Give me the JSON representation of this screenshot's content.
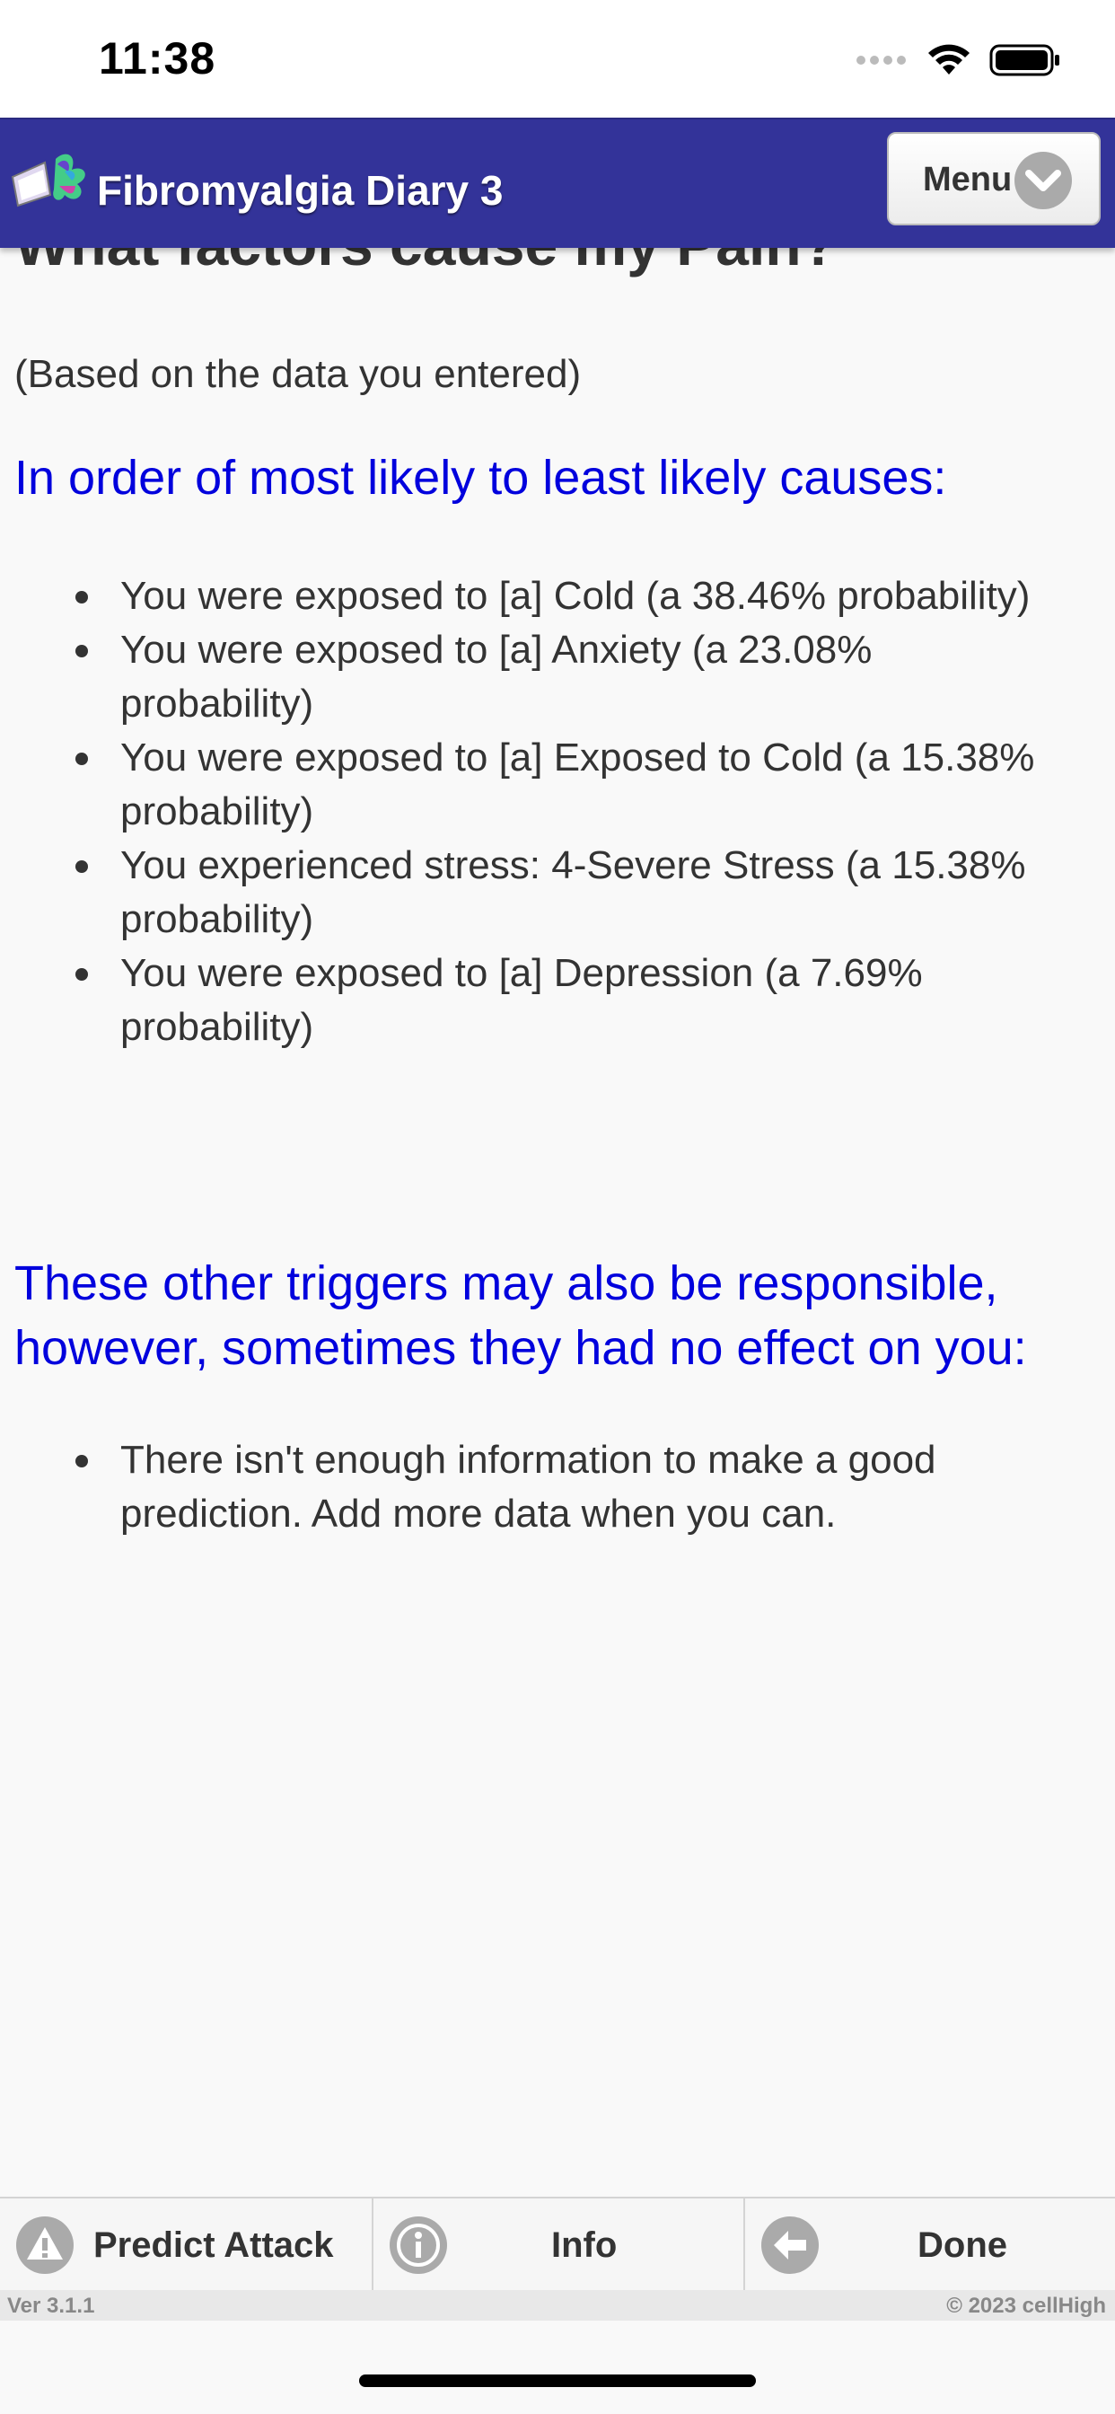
{
  "status_bar": {
    "time": "11:38"
  },
  "header": {
    "app_title": "Fibromyalgia Diary 3",
    "menu_label": "Menu"
  },
  "page": {
    "title": "What factors cause my Pain?",
    "subtitle": "(Based on the data you entered)",
    "likely_heading": "In order of most likely to least likely causes:",
    "likely_causes": [
      "You were exposed to [a] Cold (a 38.46% probability)",
      "You were exposed to [a] Anxiety (a 23.08% probability)",
      "You were exposed to [a] Exposed to Cold (a 15.38% probability)",
      "You experienced stress: 4-Severe Stress (a 15.38% probability)",
      "You were exposed to [a] Depression (a 7.69% probability)"
    ],
    "other_heading": "These other triggers may also be responsible, however, sometimes they had no effect on you:",
    "other_triggers": [
      "There isn't enough information to make a good prediction. Add more data when you can."
    ]
  },
  "tabbar": {
    "predict_label": "Predict Attack",
    "info_label": "Info",
    "done_label": "Done"
  },
  "footer": {
    "version": "Ver 3.1.1",
    "copyright": "© 2023 cellHigh"
  },
  "colors": {
    "header": "#333399",
    "heading_blue": "#0000dd",
    "background": "#f9f9f9"
  }
}
